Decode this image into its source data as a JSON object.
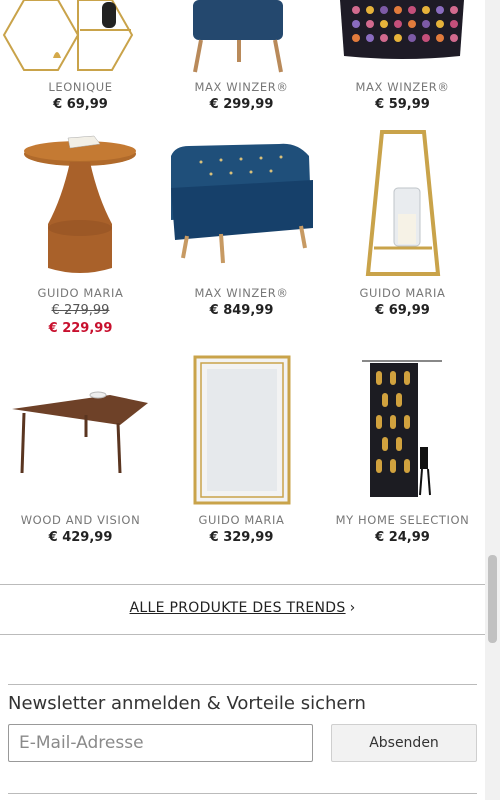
{
  "products": [
    {
      "brand": "LEONIQUE",
      "price": "€ 69,99",
      "image": "hexagon-shelf"
    },
    {
      "brand": "MAX WINZER®",
      "price": "€ 299,99",
      "image": "blue-chair"
    },
    {
      "brand": "MAX WINZER®",
      "price": "€ 59,99",
      "image": "dotted-cushion"
    },
    {
      "brand": "GUIDO MARIA",
      "old_price": "€ 279,99",
      "price": "€ 229,99",
      "image": "copper-side-table"
    },
    {
      "brand": "MAX WINZER®",
      "price": "€ 849,99",
      "image": "blue-velvet-sofa"
    },
    {
      "brand": "GUIDO MARIA",
      "price": "€ 69,99",
      "image": "gold-lantern"
    },
    {
      "brand": "WOOD AND VISION",
      "price": "€ 429,99",
      "image": "wooden-coffee-table"
    },
    {
      "brand": "GUIDO MARIA",
      "price": "€ 329,99",
      "image": "gold-frame-mirror"
    },
    {
      "brand": "MY HOME SELECTION",
      "price": "€ 24,99",
      "image": "gold-dot-curtain"
    }
  ],
  "trend_link": {
    "label": "ALLE PRODUKTE DES TRENDS",
    "chevron": "›"
  },
  "newsletter": {
    "title": "Newsletter anmelden & Vorteile sichern",
    "email_placeholder": "E-Mail-Adresse",
    "submit_label": "Absenden"
  },
  "colors": {
    "sale": "#c8102e",
    "text": "#222222",
    "brand": "#777777"
  }
}
